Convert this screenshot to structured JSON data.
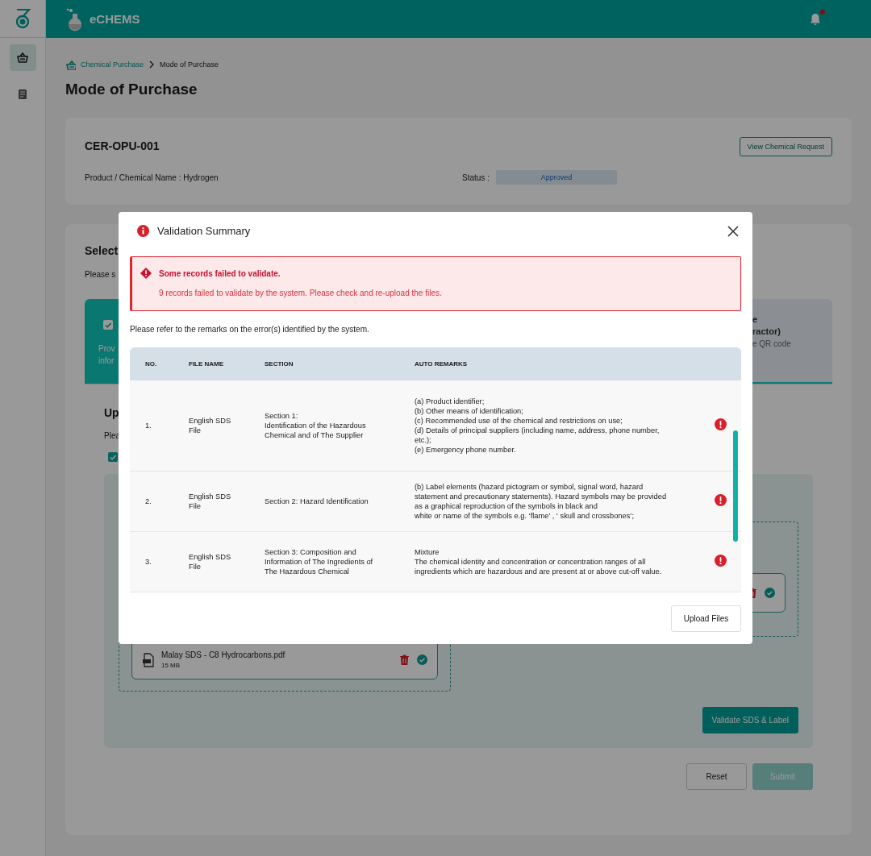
{
  "sidebar": {
    "items": [
      {
        "kind": "basket",
        "selected": true
      },
      {
        "kind": "document",
        "selected": false
      }
    ]
  },
  "header": {
    "app_name": "eCHEMS",
    "unread_notifications": true
  },
  "breadcrumb": [
    {
      "label": "Chemical Purchase",
      "kind": "link"
    },
    {
      "label": "Mode of Purchase",
      "kind": "current"
    }
  ],
  "page_title": "Mode of Purchase",
  "request_card": {
    "id": "CER-OPU-001",
    "product_line": "Product / Chemical Name : Hydrogen",
    "status_label": "Status :",
    "status": "Approved",
    "button": "View Chemical Request"
  },
  "selection_section": {
    "heading": "Select",
    "hint": "Please s",
    "options": [
      {
        "description_lines": [
          "Prov",
          "infor"
        ],
        "selected": true
      },
      {
        "title_lines": [
          "e",
          "ractor)"
        ],
        "description_lines": [
          "e QR code"
        ],
        "selected": false
      }
    ]
  },
  "upload_section": {
    "heading": "Up",
    "hint": "Plea",
    "confirm_checked": true,
    "drop_zones": [
      {
        "files": [
          {
            "name": "Malay SDS - C8 Hydrocarbons.pdf",
            "size": "15 MB",
            "valid": true
          }
        ]
      },
      {
        "files": [
          {
            "valid": true
          }
        ]
      }
    ],
    "validate_button": "Validate SDS & Label",
    "actions": [
      {
        "label": "Reset",
        "disabled": false
      },
      {
        "label": "Submit",
        "disabled": true
      }
    ]
  },
  "modal": {
    "title": "Validation Summary",
    "alert": {
      "title": "Some records failed to validate.",
      "message": "9 records failed to validate by the system. Please check and re-upload the files."
    },
    "instructions": "Please refer to the remarks on the error(s) identified by the system.",
    "table": {
      "columns": [
        "NO.",
        "FILE NAME",
        "SECTION",
        "AUTO REMARKS"
      ],
      "rows": [
        {
          "no": "1.",
          "file_name": "English SDS\nFile",
          "section": "Section 1:\nIdentification of the Hazardous\nChemical and of The Supplier",
          "remarks": "(a) Product identifier;\n(b) Other means of identification;\n(c) Recommended use of the chemical and restrictions on use;\n(d) Details of principal suppliers (including name, address, phone number,\netc.);\n(e) Emergency phone number.",
          "error": true
        },
        {
          "no": "2.",
          "file_name": "English SDS\nFile",
          "section": "Section 2: Hazard Identification",
          "remarks": "(b) Label elements (hazard pictogram or symbol, signal word, hazard\nstatement and precautionary statements). Hazard symbols may be provided\nas a graphical reproduction of the symbols in black and\nwhite or name of the symbols e.g. ‘flame’ , ‘ skull and crossbones’;",
          "error": true
        },
        {
          "no": "3.",
          "file_name": "English SDS\nFile",
          "section": "Section 3: Composition and\nInformation of The Ingredients of\nThe Hazardous Chemical",
          "remarks": "Mixture\nThe chemical identity and concentration or concentration ranges of all\ningredients which are hazardous and are present at or above cut-off value.",
          "error": true
        }
      ]
    },
    "footer_button": "Upload Files"
  }
}
